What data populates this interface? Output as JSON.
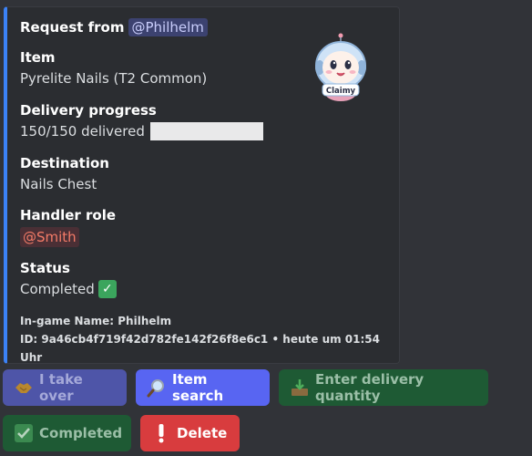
{
  "embed": {
    "header_prefix": "Request from",
    "requester_mention": "@Philhelm",
    "thumbnail_label": "Claimy",
    "fields": {
      "item": {
        "label": "Item",
        "value": "Pyrelite Nails (T2 Common)"
      },
      "progress": {
        "label": "Delivery progress",
        "value": "150/150 delivered",
        "fraction": 1.0
      },
      "destination": {
        "label": "Destination",
        "value": "Nails Chest"
      },
      "handler": {
        "label": "Handler role",
        "value": "@Smith"
      },
      "status": {
        "label": "Status",
        "value": "Completed",
        "icon": "check-mark-emoji"
      }
    },
    "footer": {
      "ingame_name": "In-game Name: Philhelm",
      "id_line": "ID: 9a46cb4f719f42d782fe142f26f8e6c1 • heute um 01:54 Uhr"
    },
    "colors": {
      "accent": "#3b82f6",
      "mention_red": "#f47b67",
      "mention_blue": "#c9cdfb"
    }
  },
  "buttons": {
    "take_over": {
      "label": "I take over",
      "icon": "handshake-icon"
    },
    "item_search": {
      "label": "Item search",
      "icon": "magnifier-icon"
    },
    "enter_quantity": {
      "label": "Enter delivery quantity",
      "icon": "inbox-tray-icon"
    },
    "completed": {
      "label": "Completed",
      "icon": "check-mark-icon"
    },
    "delete": {
      "label": "Delete",
      "icon": "exclamation-icon"
    }
  }
}
